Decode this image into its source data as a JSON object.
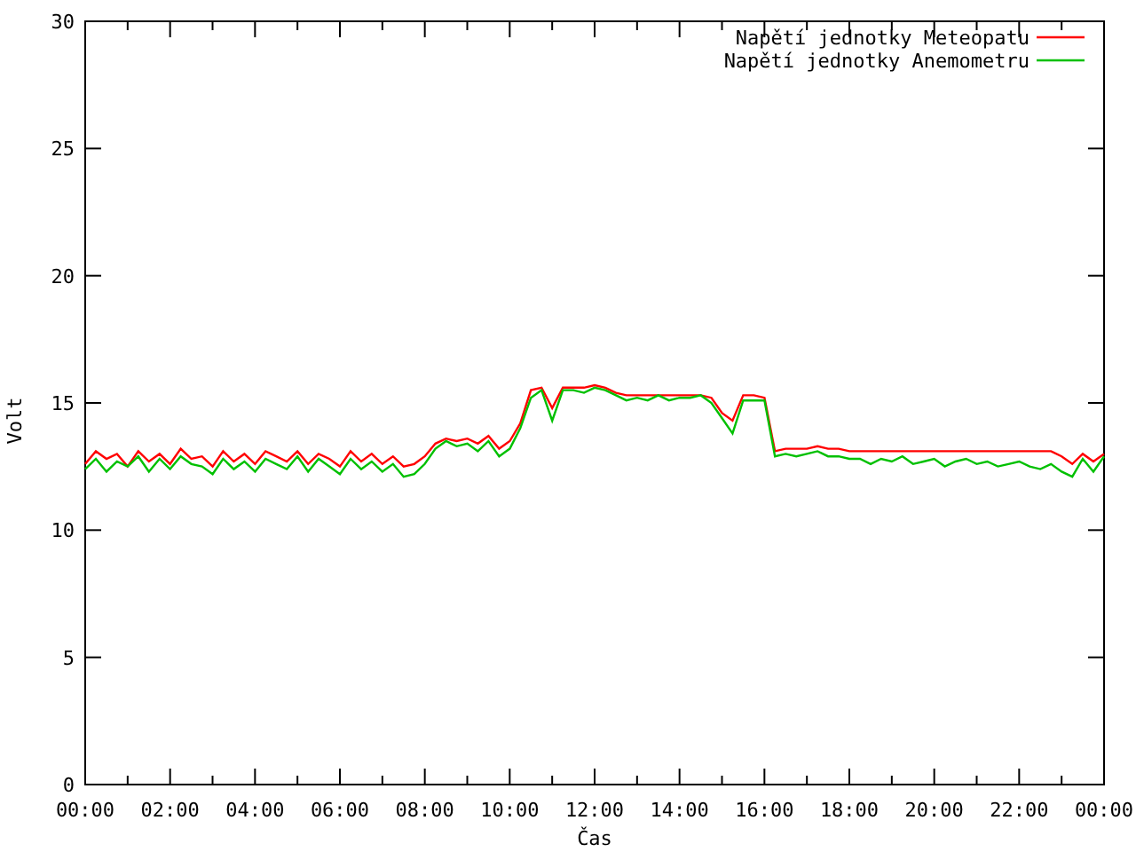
{
  "chart_data": {
    "type": "line",
    "legend": true,
    "xlabel": "Čas",
    "ylabel": "Volt",
    "xlim": [
      0,
      24
    ],
    "ylim": [
      0,
      30
    ],
    "xticks": [
      {
        "value": 0,
        "label": "00:00"
      },
      {
        "value": 2,
        "label": "02:00"
      },
      {
        "value": 4,
        "label": "04:00"
      },
      {
        "value": 6,
        "label": "06:00"
      },
      {
        "value": 8,
        "label": "08:00"
      },
      {
        "value": 10,
        "label": "10:00"
      },
      {
        "value": 12,
        "label": "12:00"
      },
      {
        "value": 14,
        "label": "14:00"
      },
      {
        "value": 16,
        "label": "16:00"
      },
      {
        "value": 18,
        "label": "18:00"
      },
      {
        "value": 20,
        "label": "20:00"
      },
      {
        "value": 22,
        "label": "22:00"
      },
      {
        "value": 24,
        "label": "00:00"
      }
    ],
    "yticks": [
      {
        "value": 0,
        "label": "0"
      },
      {
        "value": 5,
        "label": "5"
      },
      {
        "value": 10,
        "label": "10"
      },
      {
        "value": 15,
        "label": "15"
      },
      {
        "value": 20,
        "label": "20"
      },
      {
        "value": 25,
        "label": "25"
      },
      {
        "value": 30,
        "label": "30"
      }
    ],
    "x": [
      0,
      0.25,
      0.5,
      0.75,
      1,
      1.25,
      1.5,
      1.75,
      2,
      2.25,
      2.5,
      2.75,
      3,
      3.25,
      3.5,
      3.75,
      4,
      4.25,
      4.5,
      4.75,
      5,
      5.25,
      5.5,
      5.75,
      6,
      6.25,
      6.5,
      6.75,
      7,
      7.25,
      7.5,
      7.75,
      8,
      8.25,
      8.5,
      8.75,
      9,
      9.25,
      9.5,
      9.75,
      10,
      10.25,
      10.5,
      10.75,
      11,
      11.25,
      11.5,
      11.75,
      12,
      12.25,
      12.5,
      12.75,
      13,
      13.25,
      13.5,
      13.75,
      14,
      14.25,
      14.5,
      14.75,
      15,
      15.25,
      15.5,
      15.75,
      16,
      16.25,
      16.5,
      16.75,
      17,
      17.25,
      17.5,
      17.75,
      18,
      18.25,
      18.5,
      18.75,
      19,
      19.25,
      19.5,
      19.75,
      20,
      20.25,
      20.5,
      20.75,
      21,
      21.25,
      21.5,
      21.75,
      22,
      22.25,
      22.5,
      22.75,
      23,
      23.25,
      23.5,
      23.75,
      24
    ],
    "series": [
      {
        "name": "Napětí jednotky Meteopatu",
        "color": "#ff0000",
        "values": [
          12.6,
          13.1,
          12.8,
          13.0,
          12.5,
          13.1,
          12.7,
          13.0,
          12.6,
          13.2,
          12.8,
          12.9,
          12.5,
          13.1,
          12.7,
          13.0,
          12.6,
          13.1,
          12.9,
          12.7,
          13.1,
          12.6,
          13.0,
          12.8,
          12.5,
          13.1,
          12.7,
          13.0,
          12.6,
          12.9,
          12.5,
          12.6,
          12.9,
          13.4,
          13.6,
          13.5,
          13.6,
          13.4,
          13.7,
          13.2,
          13.5,
          14.2,
          15.5,
          15.6,
          14.8,
          15.6,
          15.6,
          15.6,
          15.7,
          15.6,
          15.4,
          15.3,
          15.3,
          15.3,
          15.3,
          15.3,
          15.3,
          15.3,
          15.3,
          15.2,
          14.6,
          14.3,
          15.3,
          15.3,
          15.2,
          13.1,
          13.2,
          13.2,
          13.2,
          13.3,
          13.2,
          13.2,
          13.1,
          13.1,
          13.1,
          13.1,
          13.1,
          13.1,
          13.1,
          13.1,
          13.1,
          13.1,
          13.1,
          13.1,
          13.1,
          13.1,
          13.1,
          13.1,
          13.1,
          13.1,
          13.1,
          13.1,
          12.9,
          12.6,
          13.0,
          12.7,
          13.0
        ]
      },
      {
        "name": "Napětí jednotky Anemometru",
        "color": "#00c000",
        "values": [
          12.4,
          12.8,
          12.3,
          12.7,
          12.5,
          12.9,
          12.3,
          12.8,
          12.4,
          12.9,
          12.6,
          12.5,
          12.2,
          12.8,
          12.4,
          12.7,
          12.3,
          12.8,
          12.6,
          12.4,
          12.9,
          12.3,
          12.8,
          12.5,
          12.2,
          12.8,
          12.4,
          12.7,
          12.3,
          12.6,
          12.1,
          12.2,
          12.6,
          13.2,
          13.5,
          13.3,
          13.4,
          13.1,
          13.5,
          12.9,
          13.2,
          14.0,
          15.2,
          15.5,
          14.3,
          15.5,
          15.5,
          15.4,
          15.6,
          15.5,
          15.3,
          15.1,
          15.2,
          15.1,
          15.3,
          15.1,
          15.2,
          15.2,
          15.3,
          15.0,
          14.4,
          13.8,
          15.1,
          15.1,
          15.1,
          12.9,
          13.0,
          12.9,
          13.0,
          13.1,
          12.9,
          12.9,
          12.8,
          12.8,
          12.6,
          12.8,
          12.7,
          12.9,
          12.6,
          12.7,
          12.8,
          12.5,
          12.7,
          12.8,
          12.6,
          12.7,
          12.5,
          12.6,
          12.7,
          12.5,
          12.4,
          12.6,
          12.3,
          12.1,
          12.8,
          12.3,
          12.9
        ]
      }
    ]
  }
}
